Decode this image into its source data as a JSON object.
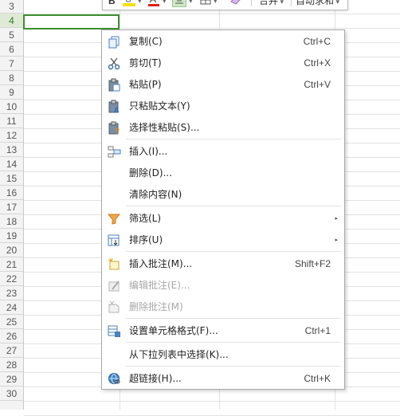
{
  "toolbar": {
    "bold": "B",
    "font_color": "A",
    "merge": "合并",
    "auto_sum": "自动求和"
  },
  "row_headers": [
    "3",
    "4",
    "5",
    "6",
    "7",
    "8",
    "9",
    "10",
    "11",
    "12",
    "13",
    "14",
    "15",
    "16",
    "17",
    "18",
    "19",
    "20",
    "21",
    "22",
    "23",
    "24",
    "25",
    "26",
    "27",
    "28",
    "29",
    "30"
  ],
  "active_row": "4",
  "context_menu": {
    "items": [
      {
        "label": "复制(C)",
        "shortcut": "Ctrl+C",
        "icon": "copy-icon",
        "disabled": false
      },
      {
        "label": "剪切(T)",
        "shortcut": "Ctrl+X",
        "icon": "scissors-icon",
        "disabled": false
      },
      {
        "label": "粘贴(P)",
        "shortcut": "Ctrl+V",
        "icon": "paste-icon",
        "disabled": false
      },
      {
        "label": "只粘贴文本(Y)",
        "shortcut": "",
        "icon": "paste-text-icon",
        "disabled": false
      },
      {
        "label": "选择性粘贴(S)...",
        "shortcut": "",
        "icon": "paste-special-icon",
        "disabled": false
      },
      {
        "label": "插入(I)...",
        "shortcut": "",
        "icon": "insert-icon",
        "disabled": false
      },
      {
        "label": "删除(D)...",
        "shortcut": "",
        "icon": "",
        "disabled": false
      },
      {
        "label": "清除内容(N)",
        "shortcut": "",
        "icon": "",
        "disabled": false
      },
      {
        "label": "筛选(L)",
        "shortcut": "",
        "icon": "filter-icon",
        "disabled": false,
        "submenu": true
      },
      {
        "label": "排序(U)",
        "shortcut": "",
        "icon": "sort-icon",
        "disabled": false,
        "submenu": true
      },
      {
        "label": "插入批注(M)...",
        "shortcut": "Shift+F2",
        "icon": "insert-comment-icon",
        "disabled": false
      },
      {
        "label": "编辑批注(E)...",
        "shortcut": "",
        "icon": "edit-comment-icon",
        "disabled": true
      },
      {
        "label": "删除批注(M)",
        "shortcut": "",
        "icon": "delete-comment-icon",
        "disabled": true
      },
      {
        "label": "设置单元格格式(F)...",
        "shortcut": "Ctrl+1",
        "icon": "format-cells-icon",
        "disabled": false
      },
      {
        "label": "从下拉列表中选择(K)...",
        "shortcut": "",
        "icon": "",
        "disabled": false
      },
      {
        "label": "超链接(H)...",
        "shortcut": "Ctrl+K",
        "icon": "hyperlink-icon",
        "disabled": false
      }
    ]
  },
  "colors": {
    "active_border": "#3c8f2f",
    "highlight_yellow": "#f4e10a",
    "font_red": "#e0201b"
  }
}
